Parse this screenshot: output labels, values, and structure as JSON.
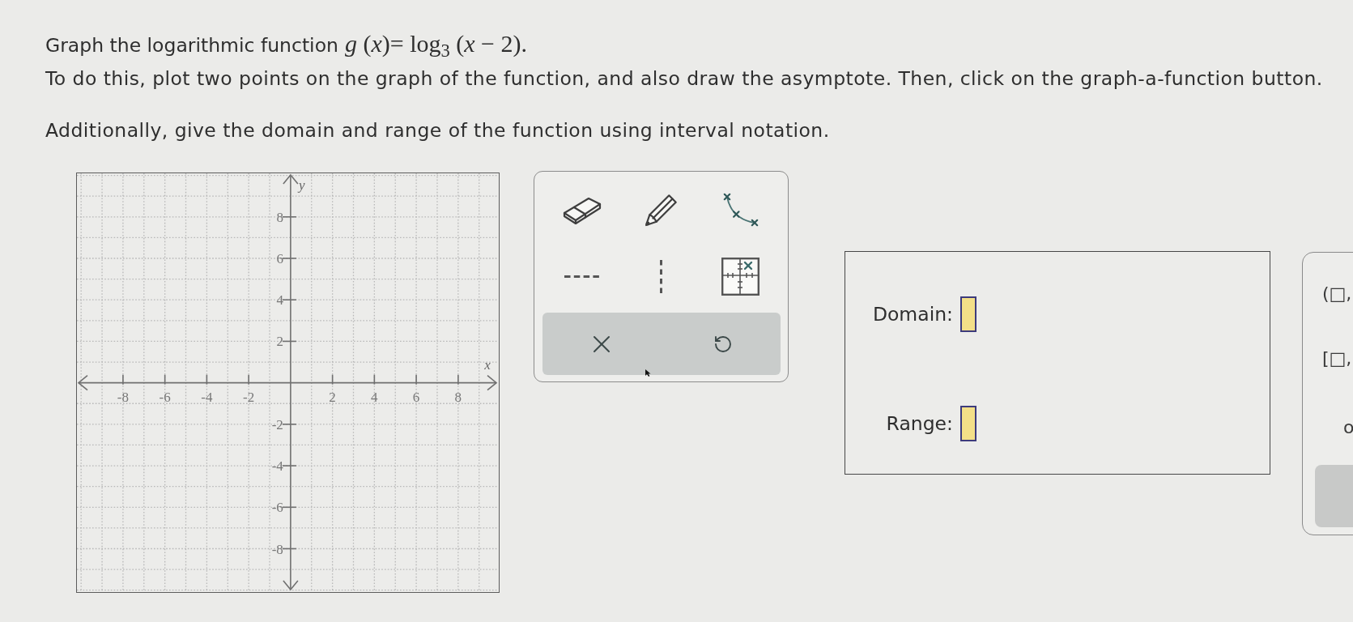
{
  "question": {
    "prompt": "Graph the logarithmic function",
    "formula": "*g* (*x*)= log$_{3}$ (*x* − 2)."
  },
  "instructions": [
    "To do this, plot two points on the graph of the function, and also draw the asymptote. Then, click on the graph-a-function button.",
    "Additionally, give the domain and range of the function using interval notation."
  ],
  "graph": {
    "chart_data": {
      "type": "line",
      "xlabel": "x",
      "ylabel": "y",
      "xlim": [
        -10.2,
        9.9
      ],
      "ylim": [
        -10.05,
        10.1
      ],
      "xticks": [
        -8,
        -6,
        -4,
        -2,
        2,
        4,
        6,
        8
      ],
      "yticks": [
        -8,
        -6,
        -4,
        -2,
        2,
        4,
        6,
        8
      ],
      "grid": true
    }
  },
  "answer_fields": [
    {
      "label": "Domain:"
    },
    {
      "label": "Range:"
    }
  ],
  "keypad": {
    "keys": [
      "(□,",
      "[□,",
      "o"
    ]
  }
}
